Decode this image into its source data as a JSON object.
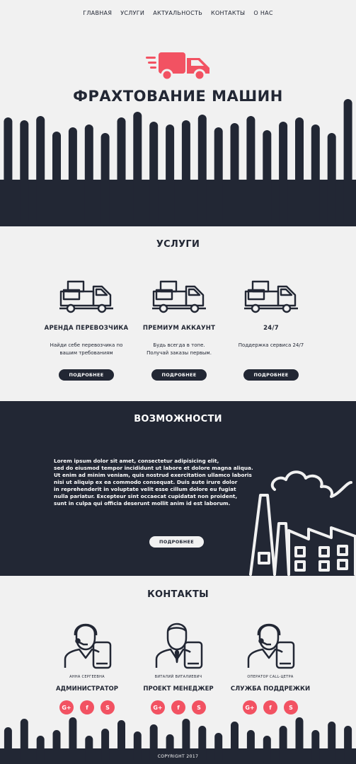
{
  "nav": [
    {
      "label": "ГЛАВНАЯ"
    },
    {
      "label": "УСЛУГИ"
    },
    {
      "label": "АКТУАЛЬНОСТЬ"
    },
    {
      "label": "КОНТАКТЫ"
    },
    {
      "label": "О НАС"
    }
  ],
  "hero": {
    "title": "ФРАХТОВАНИЕ МАШИН",
    "icon": "delivery-truck-icon"
  },
  "services": {
    "title": "УСЛУГИ",
    "items": [
      {
        "name": "АРЕНДА ПЕРЕВОЗЧИКА",
        "desc1": "Найди себе перевозчика по",
        "desc2": "вашим требованиям",
        "button": "ПОДРОБНЕЕ"
      },
      {
        "name": "ПРЕМИУМ АККАУНТ",
        "desc1": "Будь всегда в топе.",
        "desc2": "Получай заказы первым.",
        "button": "ПОДРОБНЕЕ"
      },
      {
        "name": "24/7",
        "desc1": "Поддержка сервиса 24/7",
        "desc2": "",
        "button": "ПОДРОБНЕЕ"
      }
    ]
  },
  "features": {
    "title": "ВОЗМОЖНОСТИ",
    "lines": [
      "Lorem ipsum dolor sit amet, consectetur adipisicing elit,",
      "sed do eiusmod tempor incididunt ut labore et dolore magna aliqua.",
      "Ut enim ad minim veniam, quis nostrud exercitation ullamco laboris",
      "nisi ut aliquip ex ea commodo consequat. Duis aute irure dolor",
      "in reprehenderit in voluptate velit esse cillum dolore eu fugiat",
      "nulla pariatur. Excepteur sint occaecat cupidatat non proident,",
      "sunt in culpa qui officia deserunt mollit anim id est laborum."
    ],
    "button": "ПОДРОБНЕЕ",
    "icon": "factory-icon"
  },
  "contacts": {
    "title": "КОНТАКТЫ",
    "people": [
      {
        "name": "АННА СЕРГЕЕВНА",
        "role": "АДМИНИСТРАТОР"
      },
      {
        "name": "ВИТАЛИЙ ВИТАЛИЕВИЧ",
        "role": "ПРОЕКТ МЕНЕДЖЕР"
      },
      {
        "name": "ОПЕРАТОР CALL-ЦЕТРА",
        "role": "СЛУЖБА ПОДДРЕЖКИ"
      }
    ],
    "social": [
      "G+",
      "f",
      "S"
    ]
  },
  "footer": {
    "copyright": "COPYRIGHT 2017"
  },
  "colors": {
    "dark": "#222734",
    "light": "#f1f1f1",
    "accent": "#f25262"
  }
}
